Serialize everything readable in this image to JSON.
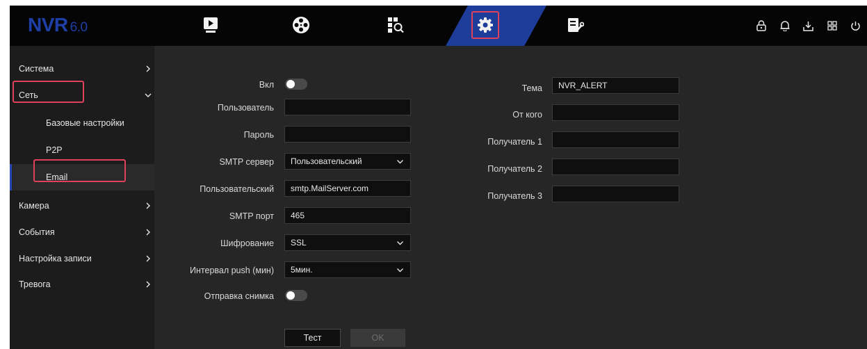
{
  "app": {
    "logo": "NVR",
    "version": "6.0"
  },
  "nav": {
    "tabs": [
      {
        "name": "playback",
        "icon": "play-icon"
      },
      {
        "name": "ptz",
        "icon": "film-reel-icon"
      },
      {
        "name": "search",
        "icon": "search-grid-icon"
      },
      {
        "name": "settings",
        "icon": "gear-icon",
        "active": true
      },
      {
        "name": "maintenance",
        "icon": "maintenance-icon"
      }
    ],
    "right_icons": [
      "lock-icon",
      "bell-icon",
      "download-icon",
      "grid-icon",
      "power-icon"
    ]
  },
  "sidebar": {
    "items": [
      {
        "label": "Система",
        "expanded": false
      },
      {
        "label": "Сеть",
        "expanded": true,
        "children": [
          {
            "label": "Базовые настройки"
          },
          {
            "label": "P2P"
          },
          {
            "label": "Email",
            "selected": true
          }
        ]
      },
      {
        "label": "Камера",
        "expanded": false
      },
      {
        "label": "События",
        "expanded": false
      },
      {
        "label": "Настройка записи",
        "expanded": false
      },
      {
        "label": "Тревога",
        "expanded": false
      }
    ]
  },
  "form": {
    "enable": {
      "label": "Вкл",
      "on": false
    },
    "user": {
      "label": "Пользователь",
      "value": ""
    },
    "password": {
      "label": "Пароль",
      "value": ""
    },
    "smtp_server": {
      "label": "SMTP сервер",
      "value": "Пользовательский"
    },
    "custom": {
      "label": "Пользовательский",
      "value": "smtp.MailServer.com"
    },
    "smtp_port": {
      "label": "SMTP порт",
      "value": "465"
    },
    "encryption": {
      "label": "Шифрование",
      "value": "SSL"
    },
    "push_interval": {
      "label": "Интервал push (мин)",
      "value": "5мин."
    },
    "send_snapshot": {
      "label": "Отправка снимка",
      "on": false
    },
    "subject": {
      "label": "Тема",
      "value": "NVR_ALERT"
    },
    "from": {
      "label": "От кого",
      "value": ""
    },
    "recipient1": {
      "label": "Получатель 1",
      "value": ""
    },
    "recipient2": {
      "label": "Получатель 2",
      "value": ""
    },
    "recipient3": {
      "label": "Получатель 3",
      "value": ""
    }
  },
  "buttons": {
    "test": "Тест",
    "ok": "OK"
  },
  "colors": {
    "accent": "#1e3c9a",
    "highlight": "#e0415a",
    "background": "#262626",
    "topbar": "#050505"
  }
}
